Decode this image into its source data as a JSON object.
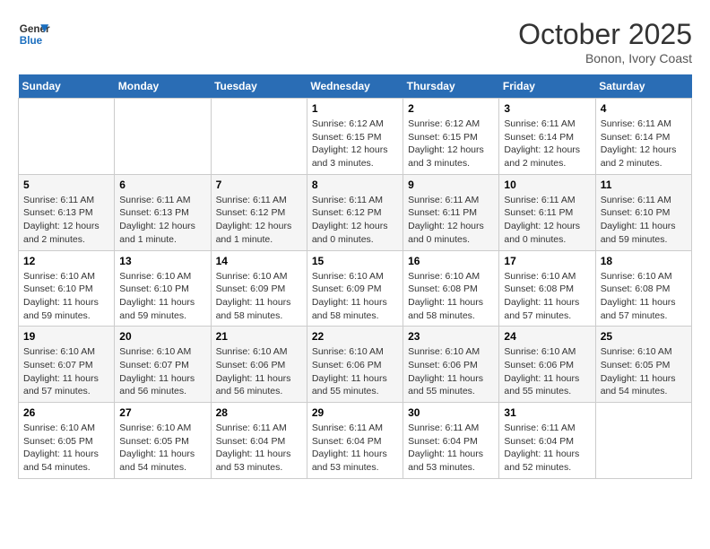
{
  "logo": {
    "line1": "General",
    "line2": "Blue"
  },
  "title": "October 2025",
  "subtitle": "Bonon, Ivory Coast",
  "header_days": [
    "Sunday",
    "Monday",
    "Tuesday",
    "Wednesday",
    "Thursday",
    "Friday",
    "Saturday"
  ],
  "weeks": [
    [
      {
        "day": "",
        "info": ""
      },
      {
        "day": "",
        "info": ""
      },
      {
        "day": "",
        "info": ""
      },
      {
        "day": "1",
        "info": "Sunrise: 6:12 AM\nSunset: 6:15 PM\nDaylight: 12 hours\nand 3 minutes."
      },
      {
        "day": "2",
        "info": "Sunrise: 6:12 AM\nSunset: 6:15 PM\nDaylight: 12 hours\nand 3 minutes."
      },
      {
        "day": "3",
        "info": "Sunrise: 6:11 AM\nSunset: 6:14 PM\nDaylight: 12 hours\nand 2 minutes."
      },
      {
        "day": "4",
        "info": "Sunrise: 6:11 AM\nSunset: 6:14 PM\nDaylight: 12 hours\nand 2 minutes."
      }
    ],
    [
      {
        "day": "5",
        "info": "Sunrise: 6:11 AM\nSunset: 6:13 PM\nDaylight: 12 hours\nand 2 minutes."
      },
      {
        "day": "6",
        "info": "Sunrise: 6:11 AM\nSunset: 6:13 PM\nDaylight: 12 hours\nand 1 minute."
      },
      {
        "day": "7",
        "info": "Sunrise: 6:11 AM\nSunset: 6:12 PM\nDaylight: 12 hours\nand 1 minute."
      },
      {
        "day": "8",
        "info": "Sunrise: 6:11 AM\nSunset: 6:12 PM\nDaylight: 12 hours\nand 0 minutes."
      },
      {
        "day": "9",
        "info": "Sunrise: 6:11 AM\nSunset: 6:11 PM\nDaylight: 12 hours\nand 0 minutes."
      },
      {
        "day": "10",
        "info": "Sunrise: 6:11 AM\nSunset: 6:11 PM\nDaylight: 12 hours\nand 0 minutes."
      },
      {
        "day": "11",
        "info": "Sunrise: 6:11 AM\nSunset: 6:10 PM\nDaylight: 11 hours\nand 59 minutes."
      }
    ],
    [
      {
        "day": "12",
        "info": "Sunrise: 6:10 AM\nSunset: 6:10 PM\nDaylight: 11 hours\nand 59 minutes."
      },
      {
        "day": "13",
        "info": "Sunrise: 6:10 AM\nSunset: 6:10 PM\nDaylight: 11 hours\nand 59 minutes."
      },
      {
        "day": "14",
        "info": "Sunrise: 6:10 AM\nSunset: 6:09 PM\nDaylight: 11 hours\nand 58 minutes."
      },
      {
        "day": "15",
        "info": "Sunrise: 6:10 AM\nSunset: 6:09 PM\nDaylight: 11 hours\nand 58 minutes."
      },
      {
        "day": "16",
        "info": "Sunrise: 6:10 AM\nSunset: 6:08 PM\nDaylight: 11 hours\nand 58 minutes."
      },
      {
        "day": "17",
        "info": "Sunrise: 6:10 AM\nSunset: 6:08 PM\nDaylight: 11 hours\nand 57 minutes."
      },
      {
        "day": "18",
        "info": "Sunrise: 6:10 AM\nSunset: 6:08 PM\nDaylight: 11 hours\nand 57 minutes."
      }
    ],
    [
      {
        "day": "19",
        "info": "Sunrise: 6:10 AM\nSunset: 6:07 PM\nDaylight: 11 hours\nand 57 minutes."
      },
      {
        "day": "20",
        "info": "Sunrise: 6:10 AM\nSunset: 6:07 PM\nDaylight: 11 hours\nand 56 minutes."
      },
      {
        "day": "21",
        "info": "Sunrise: 6:10 AM\nSunset: 6:06 PM\nDaylight: 11 hours\nand 56 minutes."
      },
      {
        "day": "22",
        "info": "Sunrise: 6:10 AM\nSunset: 6:06 PM\nDaylight: 11 hours\nand 55 minutes."
      },
      {
        "day": "23",
        "info": "Sunrise: 6:10 AM\nSunset: 6:06 PM\nDaylight: 11 hours\nand 55 minutes."
      },
      {
        "day": "24",
        "info": "Sunrise: 6:10 AM\nSunset: 6:06 PM\nDaylight: 11 hours\nand 55 minutes."
      },
      {
        "day": "25",
        "info": "Sunrise: 6:10 AM\nSunset: 6:05 PM\nDaylight: 11 hours\nand 54 minutes."
      }
    ],
    [
      {
        "day": "26",
        "info": "Sunrise: 6:10 AM\nSunset: 6:05 PM\nDaylight: 11 hours\nand 54 minutes."
      },
      {
        "day": "27",
        "info": "Sunrise: 6:10 AM\nSunset: 6:05 PM\nDaylight: 11 hours\nand 54 minutes."
      },
      {
        "day": "28",
        "info": "Sunrise: 6:11 AM\nSunset: 6:04 PM\nDaylight: 11 hours\nand 53 minutes."
      },
      {
        "day": "29",
        "info": "Sunrise: 6:11 AM\nSunset: 6:04 PM\nDaylight: 11 hours\nand 53 minutes."
      },
      {
        "day": "30",
        "info": "Sunrise: 6:11 AM\nSunset: 6:04 PM\nDaylight: 11 hours\nand 53 minutes."
      },
      {
        "day": "31",
        "info": "Sunrise: 6:11 AM\nSunset: 6:04 PM\nDaylight: 11 hours\nand 52 minutes."
      },
      {
        "day": "",
        "info": ""
      }
    ]
  ]
}
